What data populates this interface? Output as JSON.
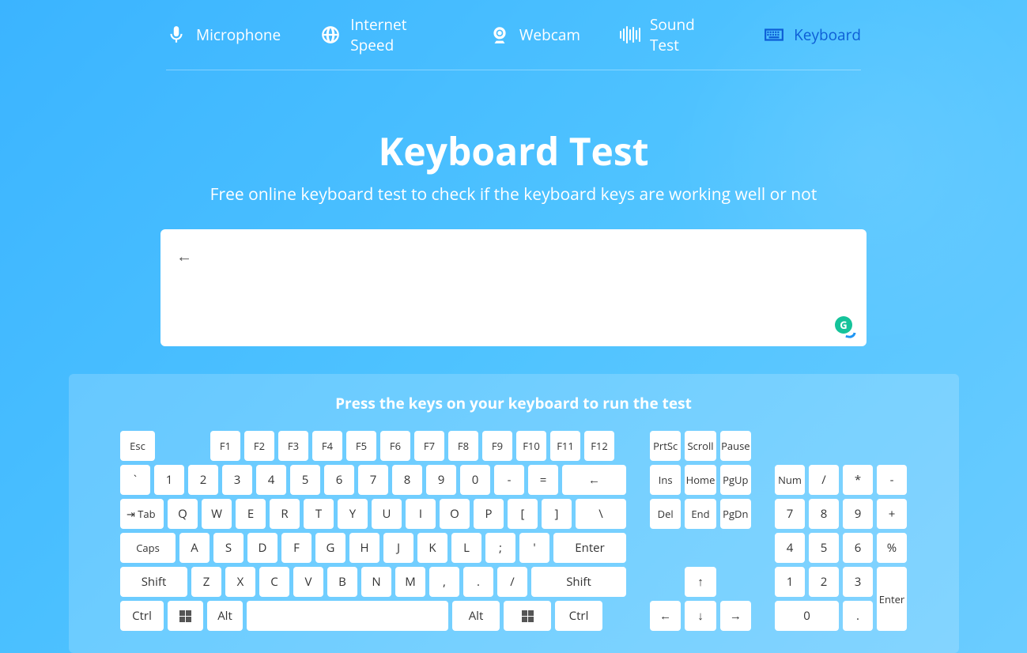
{
  "nav": {
    "items": [
      {
        "label": "Microphone",
        "icon": "microphone"
      },
      {
        "label": "Internet Speed",
        "icon": "globe"
      },
      {
        "label": "Webcam",
        "icon": "webcam"
      },
      {
        "label": "Sound Test",
        "icon": "sound"
      },
      {
        "label": "Keyboard",
        "icon": "keyboard",
        "active": true
      }
    ]
  },
  "hero": {
    "title": "Keyboard Test",
    "subtitle": "Free online keyboard test to check if the keyboard keys are working well or not"
  },
  "textarea": {
    "content": "←"
  },
  "keyboard": {
    "instruction": "Press the keys on your keyboard to run the test",
    "rows": {
      "fn": [
        "Esc",
        "F1",
        "F2",
        "F3",
        "F4",
        "F5",
        "F6",
        "F7",
        "F8",
        "F9",
        "F10",
        "F11",
        "F12"
      ],
      "num": [
        "`",
        "1",
        "2",
        "3",
        "4",
        "5",
        "6",
        "7",
        "8",
        "9",
        "0",
        "-",
        "=",
        "←"
      ],
      "qwerty": [
        "⇥ Tab",
        "Q",
        "W",
        "E",
        "R",
        "T",
        "Y",
        "U",
        "I",
        "O",
        "P",
        "[",
        "]",
        "\\"
      ],
      "asdf": [
        "Caps",
        "A",
        "S",
        "D",
        "F",
        "G",
        "H",
        "J",
        "K",
        "L",
        ";",
        "'",
        "Enter"
      ],
      "zxcv": [
        "Shift",
        "Z",
        "X",
        "C",
        "V",
        "B",
        "N",
        "M",
        ",",
        ".",
        "/",
        "Shift"
      ],
      "bottom": [
        "Ctrl",
        "Win",
        "Alt",
        "Space",
        "Alt",
        "Win",
        "Ctrl"
      ]
    },
    "navBlock": {
      "top": [
        "PrtSc",
        "Scroll",
        "Pause"
      ],
      "mid1": [
        "Ins",
        "Home",
        "PgUp"
      ],
      "mid2": [
        "Del",
        "End",
        "PgDn"
      ],
      "arrowUp": "↑",
      "arrows": [
        "←",
        "↓",
        "→"
      ]
    },
    "numpad": {
      "r1": [
        "Num",
        "/",
        "*",
        "-"
      ],
      "r2": [
        "7",
        "8",
        "9",
        "+"
      ],
      "r3": [
        "4",
        "5",
        "6",
        "%"
      ],
      "r4": [
        "1",
        "2",
        "3"
      ],
      "r5": [
        "0",
        "."
      ],
      "enter": "Enter"
    }
  }
}
